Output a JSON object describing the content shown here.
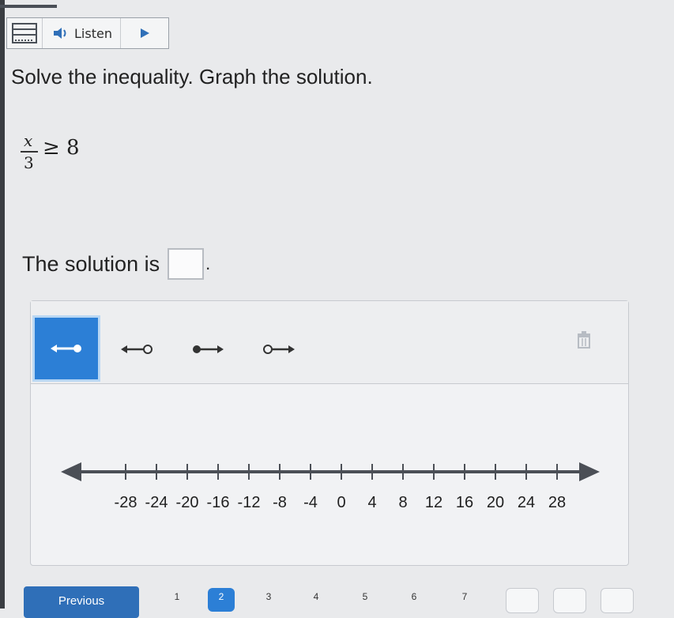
{
  "toolbar": {
    "menu_icon": "grid-menu-icon",
    "listen_label": "Listen",
    "speaker_icon": "speaker-icon",
    "play_icon": "play-icon"
  },
  "question": {
    "prompt": "Solve the inequality. Graph the solution.",
    "numerator": "x",
    "denominator": "3",
    "relation": "≥ 8"
  },
  "solution": {
    "text": "The solution is",
    "trailing": "."
  },
  "graph_tools": [
    {
      "name": "left-ray-closed-tool",
      "active": true
    },
    {
      "name": "left-ray-open-tool",
      "active": false
    },
    {
      "name": "right-ray-closed-tool",
      "active": false
    },
    {
      "name": "right-ray-open-tool",
      "active": false
    }
  ],
  "number_line": {
    "labels": [
      "-28",
      "-24",
      "-20",
      "-16",
      "-12",
      "-8",
      "-4",
      "0",
      "4",
      "8",
      "12",
      "16",
      "20",
      "24",
      "28"
    ]
  },
  "footer": {
    "previous_label": "Previous",
    "pages": [
      "1",
      "2",
      "3",
      "4",
      "5",
      "6",
      "7"
    ]
  },
  "colors": {
    "accent": "#2c7fd6",
    "line": "#4b4f56"
  }
}
